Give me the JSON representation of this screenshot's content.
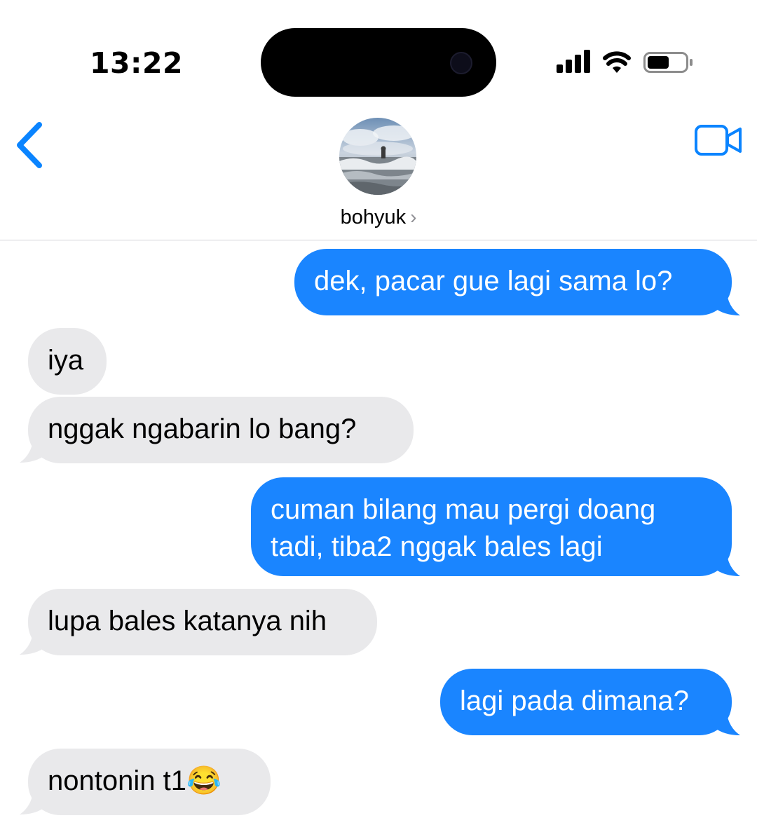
{
  "status_bar": {
    "time": "13:22",
    "icons": [
      "cellular-signal-icon",
      "wifi-icon",
      "battery-icon"
    ]
  },
  "header": {
    "back_icon": "chevron-left-icon",
    "contact_name": "bohyuk",
    "contact_chevron": "›",
    "video_icon": "video-camera-icon"
  },
  "messages": [
    {
      "from": "me",
      "text": "dek, pacar gue lagi sama lo?"
    },
    {
      "from": "them",
      "text": "iya"
    },
    {
      "from": "them",
      "text": "nggak ngabarin lo bang?"
    },
    {
      "from": "me",
      "text": "cuman bilang mau pergi doang tadi, tiba2 nggak bales lagi"
    },
    {
      "from": "them",
      "text": "lupa bales katanya nih"
    },
    {
      "from": "me",
      "text": "lagi pada dimana?"
    },
    {
      "from": "them",
      "text": "nontonin t1😂"
    }
  ],
  "colors": {
    "outgoing_bubble": "#1a85ff",
    "incoming_bubble": "#e9e9eb",
    "accent": "#0a84ff"
  }
}
